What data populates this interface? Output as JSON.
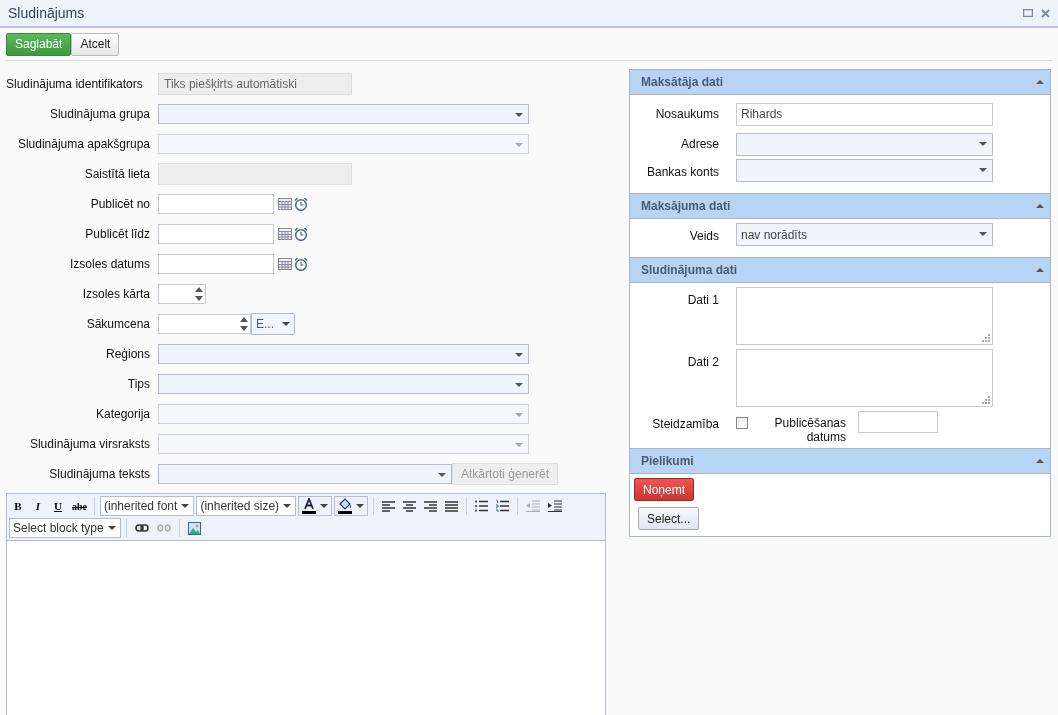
{
  "window": {
    "title": "Sludinājums"
  },
  "toolbar": [
    {
      "label": "Saglabāt",
      "kind": "primary"
    },
    {
      "label": "Atcelt",
      "kind": "default"
    }
  ],
  "form": [
    {
      "label": "Sludinājuma identifikators",
      "kind": "readonly",
      "value": "Tiks piešķirts automātiski"
    },
    {
      "label": "Sludinājuma grupa",
      "kind": "select",
      "disabled": false
    },
    {
      "label": "Sludinājuma apakšgrupa",
      "kind": "select",
      "disabled": true
    },
    {
      "label": "Saistītā lieta",
      "kind": "readonly"
    },
    {
      "label": "Publicēt no",
      "kind": "date"
    },
    {
      "label": "Publicēt līdz",
      "kind": "date"
    },
    {
      "label": "Izsoles datums",
      "kind": "date"
    },
    {
      "label": "Izsoles kārta",
      "kind": "spinner"
    },
    {
      "label": "Sākumcena",
      "kind": "money",
      "currency": "E..."
    },
    {
      "label": "Reģions",
      "kind": "select",
      "disabled": false
    },
    {
      "label": "Tips",
      "kind": "select",
      "disabled": false
    },
    {
      "label": "Kategorija",
      "kind": "select",
      "disabled": true
    },
    {
      "label": "Sludinājuma virsraksts",
      "kind": "select",
      "disabled": true
    },
    {
      "label": "Sludinājuma teksts",
      "kind": "select-button",
      "disabled": false,
      "button": "Atkārtoti ģenerēt"
    }
  ],
  "editor": {
    "rows": [
      [
        {
          "kind": "bold",
          "label": "B"
        },
        {
          "kind": "italic",
          "label": "I"
        },
        {
          "kind": "underline",
          "label": "U"
        },
        {
          "kind": "strike",
          "label": "abe"
        },
        {
          "kind": "sep"
        },
        {
          "kind": "dropdown",
          "value": "(inherited font"
        },
        {
          "kind": "dropdown",
          "value": "(inherited size)"
        },
        {
          "kind": "text-color"
        },
        {
          "kind": "highlight"
        },
        {
          "kind": "sep"
        },
        {
          "kind": "align-left"
        },
        {
          "kind": "align-center"
        },
        {
          "kind": "align-right"
        },
        {
          "kind": "justify"
        },
        {
          "kind": "sep"
        },
        {
          "kind": "bullet-list"
        },
        {
          "kind": "numbered-list"
        },
        {
          "kind": "sep"
        },
        {
          "kind": "outdent",
          "disabled": true
        },
        {
          "kind": "indent",
          "disabled": false
        }
      ],
      [
        {
          "kind": "dropdown",
          "value": "Select block type"
        },
        {
          "kind": "sep"
        },
        {
          "kind": "link",
          "disabled": false
        },
        {
          "kind": "unlink",
          "disabled": true
        },
        {
          "kind": "sep"
        },
        {
          "kind": "image"
        }
      ]
    ]
  },
  "panels": [
    {
      "title": "Maksātāja dati",
      "expanded": true,
      "fields": [
        {
          "label": "Nosaukums",
          "kind": "text",
          "value": "Rihards"
        },
        {
          "label": "Adrese",
          "kind": "select"
        },
        {
          "label": "Bankas konts",
          "kind": "select"
        }
      ]
    },
    {
      "title": "Maksājuma dati",
      "expanded": true,
      "fields": [
        {
          "label": "Veids",
          "kind": "select",
          "value": "nav norādīts"
        }
      ]
    },
    {
      "title": "Sludinājuma dati",
      "expanded": true,
      "fields": [
        {
          "label": "Dati 1",
          "kind": "textarea"
        },
        {
          "label": "Dati 2",
          "kind": "textarea"
        },
        {
          "label": "Steidzamība",
          "kind": "checkbox",
          "checked": false,
          "extra_label": "Publicēšanas datums"
        }
      ]
    },
    {
      "title": "Pielikumi",
      "expanded": true,
      "buttons": [
        {
          "label": "Noņemt",
          "kind": "danger"
        },
        {
          "label": "Select...",
          "kind": "default"
        }
      ]
    }
  ]
}
